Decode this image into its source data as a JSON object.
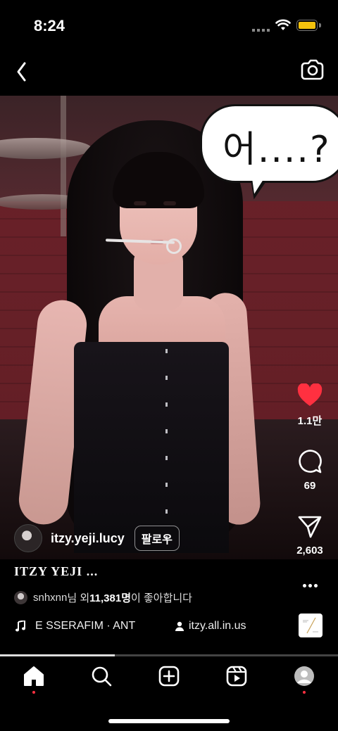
{
  "status_bar": {
    "time": "8:24"
  },
  "video": {
    "overlay_text": "어....?"
  },
  "actions": {
    "likes": "1.1만",
    "comments": "69",
    "shares": "2,603",
    "like_color": "#ff3040"
  },
  "post": {
    "username": "itzy.yeji.lucy",
    "follow_label": "팔로우",
    "caption": "ITZY YEJI ...",
    "liked_by_user": "snhxnn",
    "liked_by_mid": "님 외 ",
    "liked_by_count": "11,381명",
    "liked_by_suffix": "이 좋아합니다",
    "music": "E SSERAFIM · ANT",
    "creator": "itzy.all.in.us",
    "progress": 0.34
  },
  "tabs": [
    "home",
    "search",
    "create",
    "reels",
    "profile"
  ]
}
